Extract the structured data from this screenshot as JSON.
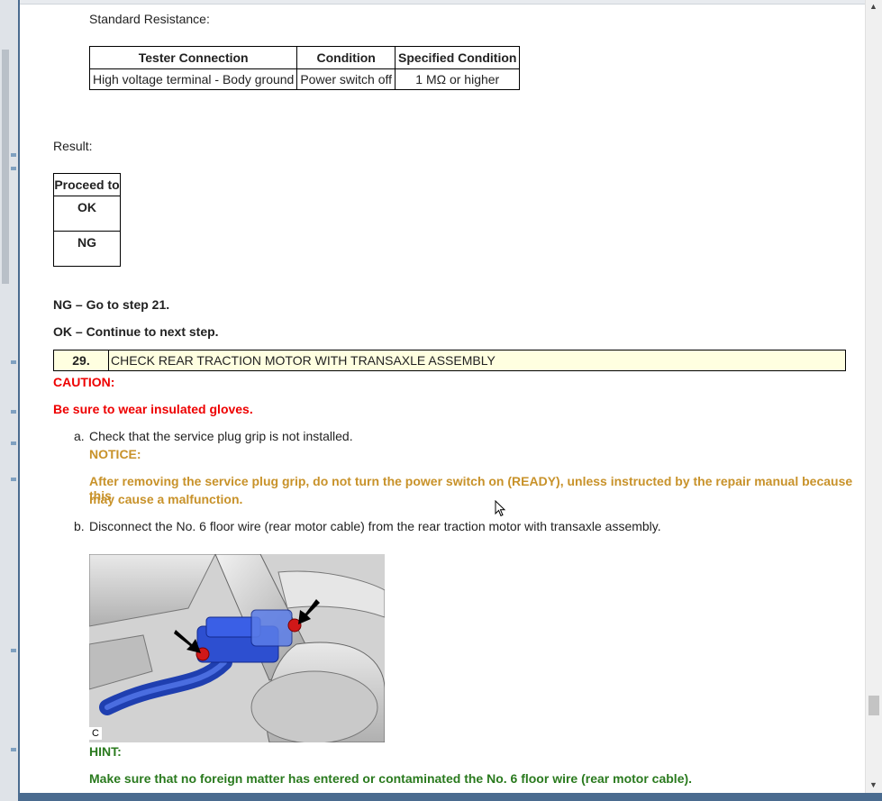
{
  "standard_resistance_label": "Standard Resistance:",
  "resistance_table": {
    "headers": [
      "Tester Connection",
      "Condition",
      "Specified Condition"
    ],
    "row": [
      "High voltage terminal - Body ground",
      "Power switch off",
      "1 MΩ or higher"
    ]
  },
  "result_label": "Result:",
  "proceed_table": {
    "header": "Proceed to",
    "rows": [
      "OK",
      "NG"
    ]
  },
  "ng_line": "NG – Go to step 21.",
  "ok_line": "OK – Continue to next step.",
  "step": {
    "number": "29.",
    "title": "CHECK REAR TRACTION MOTOR WITH TRANSAXLE ASSEMBLY"
  },
  "caution": {
    "label": "CAUTION:",
    "text": "Be sure to wear insulated gloves."
  },
  "item_a": {
    "marker": "a.",
    "text": "Check that the service plug grip is not installed.",
    "notice_label": "NOTICE:",
    "notice_line1": "After removing the service plug grip, do not turn the power switch on (READY), unless instructed by the repair manual because this",
    "notice_line2": "may cause a malfunction."
  },
  "item_b": {
    "marker": "b.",
    "text": "Disconnect the No. 6 floor wire (rear motor cable) from the rear traction motor with transaxle assembly."
  },
  "figure_label": "C",
  "hint": {
    "label": "HINT:",
    "text": "Make sure that no foreign matter has entered or contaminated the No. 6 floor wire (rear motor cable)."
  },
  "colors": {
    "caution": "#ee0000",
    "notice": "#c8922a",
    "hint": "#2a7a1e",
    "step_bg": "#ffffe0"
  }
}
